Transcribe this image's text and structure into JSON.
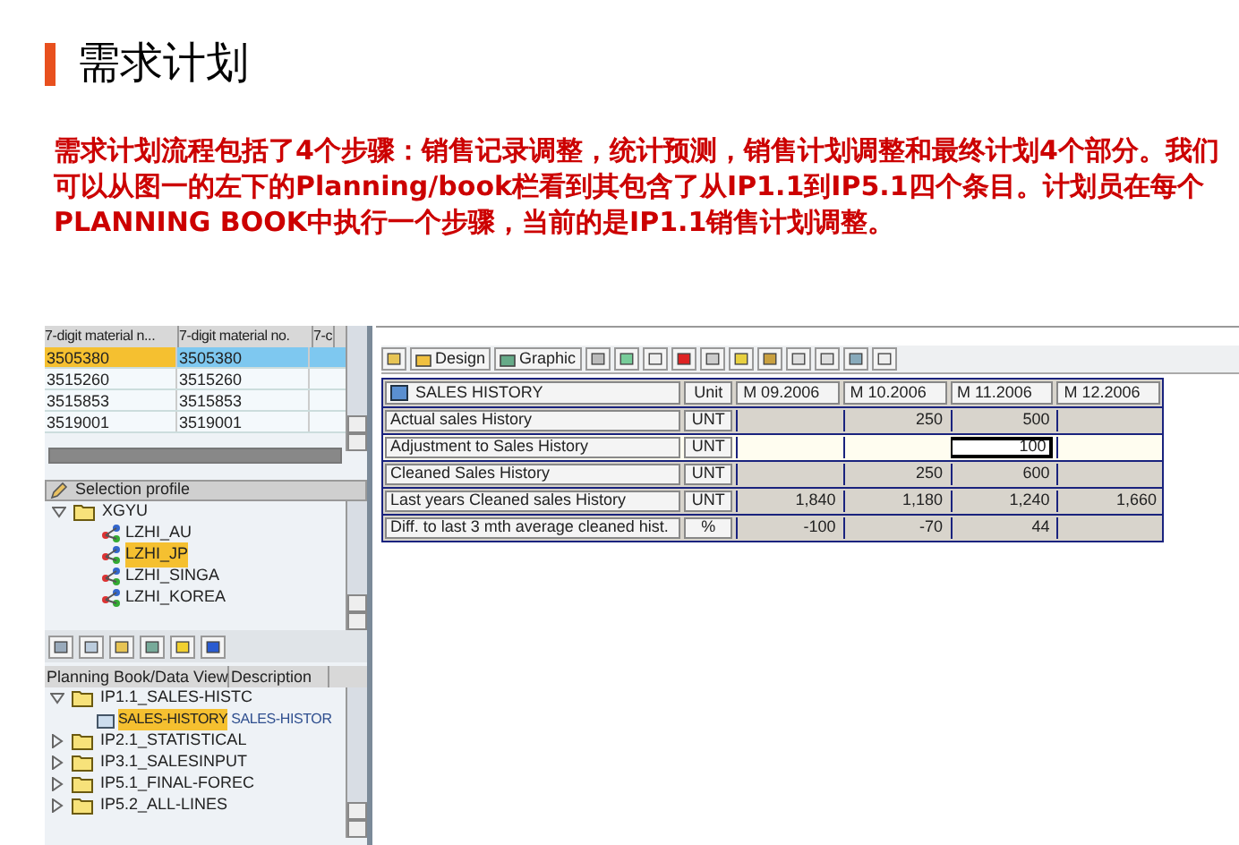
{
  "title": "需求计划",
  "intro": "需求计划流程包括了**4**个步骤：销售记录调整，统计预测，销售计划调整和最终计划**4**个部分。我们可以从图一的左下的**Planning/book**栏看到其包含了从**IP1.1**到**IP5.1**四个条目。计划员在每个**PLANNING BOOK**中执行一个步骤，当前的是**IP1.1**销售计划调整。",
  "material_table": {
    "columns": [
      "7-digit material n...",
      "7-digit material no.",
      "7-c"
    ],
    "rows": [
      {
        "cells": [
          "3505380",
          "3505380"
        ],
        "selected": true
      },
      {
        "cells": [
          "3515260",
          "3515260"
        ],
        "selected": false
      },
      {
        "cells": [
          "3515853",
          "3515853"
        ],
        "selected": false
      },
      {
        "cells": [
          "3519001",
          "3519001"
        ],
        "selected": false
      }
    ]
  },
  "selection_profile": {
    "header": "Selection profile",
    "tree": [
      {
        "label": "XGYU",
        "expanded": true,
        "selected": false,
        "children": [
          {
            "label": "LZHI_AU",
            "selected": false
          },
          {
            "label": "LZHI_JP",
            "selected": true
          },
          {
            "label": "LZHI_SINGA",
            "selected": false
          },
          {
            "label": "LZHI_KOREA",
            "selected": false
          }
        ]
      }
    ]
  },
  "planning_book": {
    "columns": [
      "Planning Book/Data View",
      "Description"
    ],
    "tree": [
      {
        "label": "IP1.1_SALES-HISTC",
        "expanded": true,
        "children": [
          {
            "label": "SALES-HISTORY",
            "description": "SALES-HISTOR",
            "selected": true
          }
        ]
      },
      {
        "label": "IP2.1_STATISTICAL",
        "expanded": false
      },
      {
        "label": "IP3.1_SALESINPUT",
        "expanded": false
      },
      {
        "label": "IP5.1_FINAL-FOREC",
        "expanded": false
      },
      {
        "label": "IP5.2_ALL-LINES",
        "expanded": false
      }
    ]
  },
  "toolbar": {
    "buttons": [
      "Design",
      "Graphic"
    ]
  },
  "grid": {
    "title": "SALES HISTORY",
    "columns": [
      "Unit",
      "M 09.2006",
      "M 10.2006",
      "M 11.2006",
      "M 12.2006"
    ],
    "rows": [
      {
        "label": "Actual sales History",
        "unit": "UNT",
        "kind": "output",
        "cells": [
          {
            "selected": false
          },
          {
            "value": "250",
            "selected": false
          },
          {
            "value": "500",
            "selected": false
          },
          {
            "selected": false
          }
        ]
      },
      {
        "label": "Adjustment to Sales History",
        "unit": "UNT",
        "kind": "input",
        "cells": [
          {
            "selected": false
          },
          {
            "selected": false
          },
          {
            "value": "100",
            "selected": true
          },
          {
            "selected": false
          }
        ]
      },
      {
        "label": "Cleaned Sales History",
        "unit": "UNT",
        "kind": "output",
        "cells": [
          {
            "selected": false
          },
          {
            "value": "250",
            "selected": false
          },
          {
            "value": "600",
            "selected": false
          },
          {
            "selected": false
          }
        ]
      },
      {
        "label": "Last years Cleaned sales History",
        "unit": "UNT",
        "kind": "output",
        "cells": [
          {
            "value": "1,840",
            "selected": false
          },
          {
            "value": "1,180",
            "selected": false
          },
          {
            "value": "1,240",
            "selected": false
          },
          {
            "value": "1,660",
            "selected": false
          }
        ]
      },
      {
        "label": "Diff. to last 3 mth average cleaned hist.",
        "unit": "%",
        "kind": "output",
        "cells": [
          {
            "value": "-100",
            "selected": false
          },
          {
            "value": "-70",
            "selected": false
          },
          {
            "value": "44",
            "selected": false
          },
          {
            "selected": false
          }
        ]
      }
    ]
  }
}
